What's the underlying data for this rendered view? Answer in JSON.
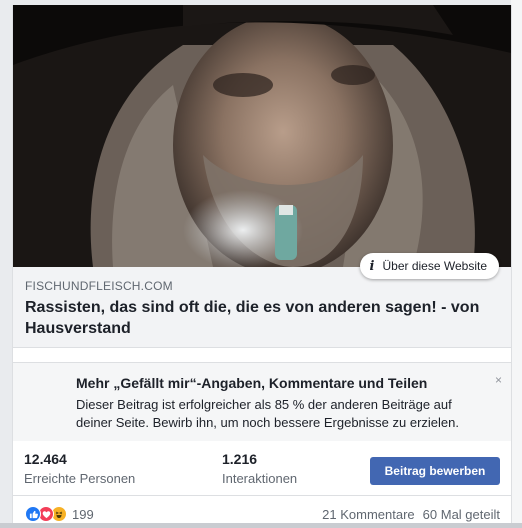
{
  "post": {
    "image_alt": "man with hat and long hair smoking pipe",
    "about_label": "Über diese Website",
    "link": {
      "domain": "FISCHUNDFLEISCH.COM",
      "headline": "Rassisten, das sind oft die, die es von anderen sagen! - von Hausverstand"
    }
  },
  "promo": {
    "title": "Mehr „Gefällt mir“-Angaben, Kommentare und Teilen",
    "text": "Dieser Beitrag ist erfolgreicher als 85 % der anderen Beiträge auf deiner Seite. Bewirb ihn, um noch bessere Ergebnisse zu erzielen.",
    "close": "×"
  },
  "stats": {
    "reach_value": "12.464",
    "reach_label": "Erreichte Personen",
    "engagement_value": "1.216",
    "engagement_label": "Interaktionen",
    "boost_button": "Beitrag bewerben"
  },
  "footer": {
    "reaction_icons": [
      "like-icon",
      "love-icon",
      "haha-icon"
    ],
    "reaction_count": "199",
    "comments": "21 Kommentare",
    "shares": "60 Mal geteilt"
  },
  "colors": {
    "accent": "#4267b2",
    "like": "#2078f4",
    "love": "#f33e58",
    "haha": "#f7b125"
  }
}
